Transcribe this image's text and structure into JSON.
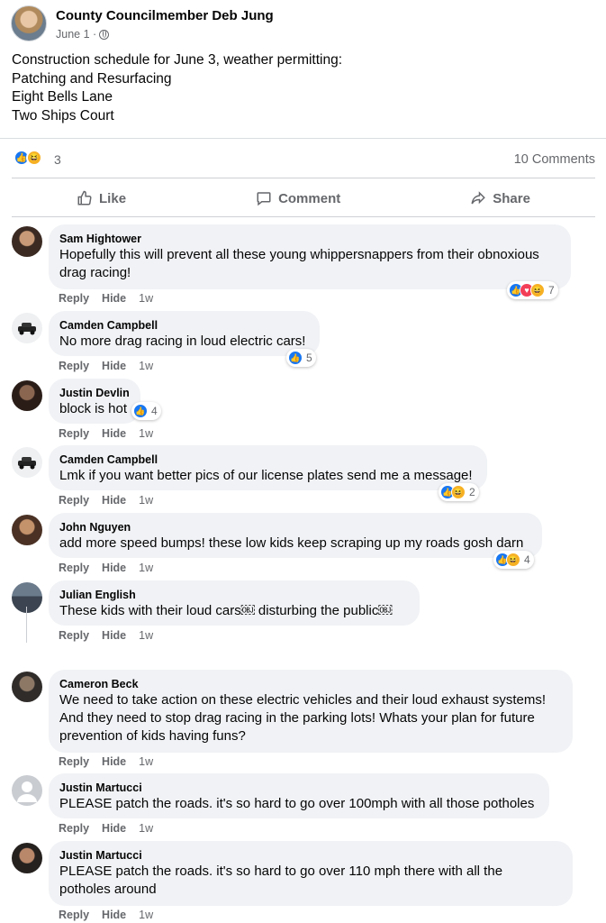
{
  "post": {
    "author": "County Councilmember Deb Jung",
    "date": "June 1 ·",
    "lines": [
      "Construction schedule for June 3, weather permitting:",
      "Patching and Resurfacing",
      "Eight Bells Lane",
      "Two Ships Court"
    ]
  },
  "stats": {
    "reaction_count": "3",
    "comments_label": "10 Comments"
  },
  "actions": {
    "like": "Like",
    "comment": "Comment",
    "share": "Share"
  },
  "comment_actions": {
    "reply": "Reply",
    "hide": "Hide"
  },
  "comments": [
    {
      "name": "Sam Hightower",
      "lines": [
        "Hopefully this will prevent all these young whippersnappers from their obnoxious",
        "drag racing!"
      ],
      "time": "1w",
      "reactions": "7"
    },
    {
      "name": "Camden Campbell",
      "lines": [
        "No more drag racing in loud electric cars!"
      ],
      "time": "1w",
      "reactions": "5"
    },
    {
      "name": "Justin Devlin",
      "lines": [
        "block is hot"
      ],
      "time": "1w",
      "reactions": "4"
    },
    {
      "name": "Camden Campbell",
      "lines": [
        "Lmk if you want better pics of our license plates send me a message!"
      ],
      "time": "1w",
      "reactions": "2"
    },
    {
      "name": "John Nguyen",
      "lines": [
        "add more speed bumps! these low kids keep scraping up my roads gosh darn"
      ],
      "time": "1w",
      "reactions": "4"
    },
    {
      "name": "Julian English",
      "lines": [
        "These kids with their loud cars￼ disturbing the public￼"
      ],
      "time": "1w"
    },
    {
      "name": "Cameron Beck",
      "lines": [
        "We need to take action on these electric vehicles and their loud exhaust systems!",
        "And they need to stop drag racing in the parking lots! Whats your plan for future",
        "prevention of kids having funs?"
      ],
      "time": "1w"
    },
    {
      "name": "Justin Martucci",
      "lines": [
        "PLEASE patch the roads. it's so hard to go over 100mph with all those potholes"
      ],
      "time": "1w"
    },
    {
      "name": "Justin Martucci",
      "lines": [
        "PLEASE patch the roads. it's so hard to go over 110 mph there with all the",
        "potholes around"
      ],
      "time": "1w"
    }
  ]
}
